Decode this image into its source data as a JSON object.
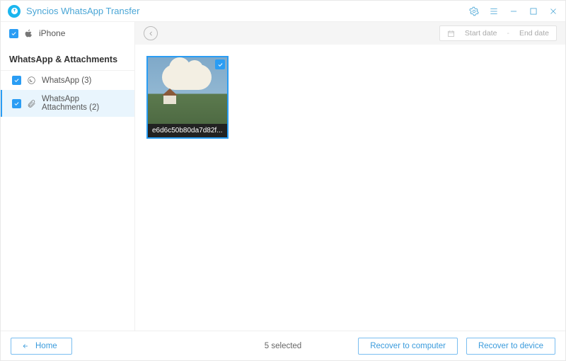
{
  "app": {
    "title": "Syncios WhatsApp Transfer"
  },
  "device": {
    "name": "iPhone"
  },
  "datePicker": {
    "start": "Start date",
    "end": "End date",
    "sep": "-"
  },
  "sidebar": {
    "header": "WhatsApp & Attachments",
    "items": [
      {
        "label": "WhatsApp (3)"
      },
      {
        "label": "WhatsApp Attachments (2)"
      }
    ]
  },
  "thumbs": [
    {
      "caption": "e6d6c50b80da7d82f..."
    }
  ],
  "footer": {
    "home": "Home",
    "status": "5 selected",
    "recoverComputer": "Recover to computer",
    "recoverDevice": "Recover to device"
  }
}
